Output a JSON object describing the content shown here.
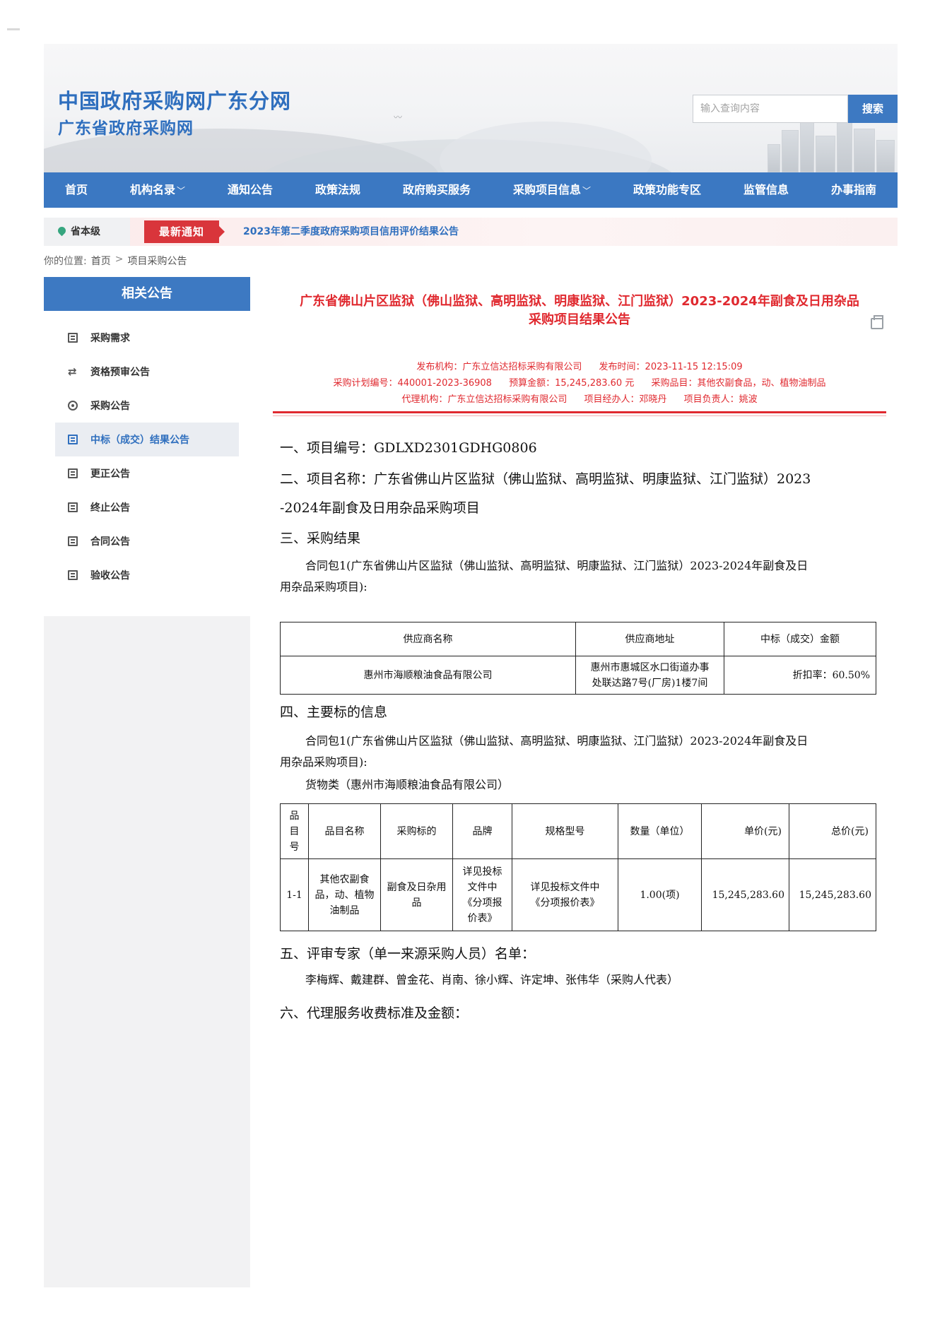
{
  "header": {
    "site_title": "中国政府采购网广东分网",
    "site_subtitle": "广东省政府采购网",
    "search_placeholder": "输入查询内容",
    "search_button": "搜索"
  },
  "nav": {
    "items": [
      {
        "label": "首页",
        "has_dropdown": false
      },
      {
        "label": "机构名录",
        "has_dropdown": true
      },
      {
        "label": "通知公告",
        "has_dropdown": false
      },
      {
        "label": "政策法规",
        "has_dropdown": false
      },
      {
        "label": "政府购买服务",
        "has_dropdown": false
      },
      {
        "label": "采购项目信息",
        "has_dropdown": true
      },
      {
        "label": "政策功能专区",
        "has_dropdown": false
      },
      {
        "label": "监管信息",
        "has_dropdown": false
      },
      {
        "label": "办事指南",
        "has_dropdown": false
      }
    ]
  },
  "notice": {
    "region": "省本级",
    "badge": "最新通知",
    "link": "2023年第二季度政府采购项目信用评价结果公告"
  },
  "breadcrumb": {
    "label": "你的位置:",
    "items": [
      "首页",
      "项目采购公告"
    ]
  },
  "sidebar": {
    "title": "相关公告",
    "items": [
      {
        "label": "采购需求",
        "icon": "document-icon"
      },
      {
        "label": "资格预审公告",
        "icon": "cycle-icon"
      },
      {
        "label": "采购公告",
        "icon": "target-icon"
      },
      {
        "label": "中标（成交）结果公告",
        "icon": "document-icon",
        "active": true
      },
      {
        "label": "更正公告",
        "icon": "document-icon"
      },
      {
        "label": "终止公告",
        "icon": "document-icon"
      },
      {
        "label": "合同公告",
        "icon": "document-icon"
      },
      {
        "label": "验收公告",
        "icon": "document-icon"
      }
    ]
  },
  "article": {
    "title_line1": "广东省佛山片区监狱（佛山监狱、高明监狱、明康监狱、江门监狱）2023-2024年副食及日用杂品",
    "title_line2": "采购项目结果公告",
    "meta": {
      "publisher_label": "发布机构：",
      "publisher": "广东立信达招标采购有限公司",
      "time_label": "发布时间：",
      "time": "2023-11-15 12:15:09",
      "plan_label": "采购计划编号：",
      "plan": "440001-2023-36908",
      "budget_label": "预算金额：",
      "budget": "15,245,283.60 元",
      "category_label": "采购品目：",
      "category": "其他农副食品，动、植物油制品",
      "agency_label": "代理机构：",
      "agency": "广东立信达招标采购有限公司",
      "manager_label": "项目经办人：",
      "manager": "邓晓丹",
      "owner_label": "项目负责人：",
      "owner": "姚波"
    },
    "s1": "一、项目编号：GDLXD2301GDHG0806",
    "s2_line1": "二、项目名称：广东省佛山片区监狱（佛山监狱、高明监狱、明康监狱、江门监狱）2023",
    "s2_line2": "-2024年副食及日用杂品采购项目",
    "s3": "三、采购结果",
    "s3_p1": "合同包1(广东省佛山片区监狱（佛山监狱、高明监狱、明康监狱、江门监狱）2023-2024年副食及日",
    "s3_p2": "用杂品采购项目):",
    "table1": {
      "headers": [
        "供应商名称",
        "供应商地址",
        "中标（成交）金额"
      ],
      "row": {
        "name": "惠州市海顺粮油食品有限公司",
        "address_line1": "惠州市惠城区水口街道办事",
        "address_line2": "处联达路7号(厂房)1楼7间",
        "amount": "折扣率：60.50%"
      }
    },
    "s4": "四、主要标的信息",
    "s4_p1": "合同包1(广东省佛山片区监狱（佛山监狱、高明监狱、明康监狱、江门监狱）2023-2024年副食及日",
    "s4_p2": "用杂品采购项目):",
    "s4_p3": "货物类（惠州市海顺粮油食品有限公司）",
    "table2": {
      "headers": [
        "品目号",
        "品目名称",
        "采购标的",
        "品牌",
        "规格型号",
        "数量（单位）",
        "单价(元)",
        "总价(元)"
      ],
      "row": {
        "no": "1-1",
        "name": "其他农副食品，动、植物油制品",
        "target": "副食及日杂用品",
        "brand": "详见投标文件中《分项报价表》",
        "spec": "详见投标文件中《分项报价表》",
        "qty": "1.00(项)",
        "unit_price": "15,245,283.60",
        "total_price": "15,245,283.60"
      }
    },
    "s5": "五、评审专家（单一来源采购人员）名单：",
    "s5_p1": "李梅辉、戴建群、曾金花、肖南、徐小辉、许定坤、张伟华（采购人代表）",
    "s6": "六、代理服务收费标准及金额："
  }
}
